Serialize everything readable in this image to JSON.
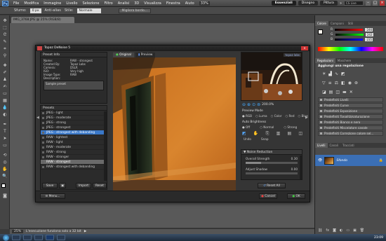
{
  "app": {
    "logo": "Ps",
    "menu": [
      "File",
      "Modifica",
      "Immagine",
      "Livello",
      "Selezione",
      "Filtro",
      "Analisi",
      "3D",
      "Visualizza",
      "Finestra",
      "Aiuto"
    ],
    "zoom_indicator": "33%",
    "workspaces": [
      "Essenziali",
      "Disegno",
      "Pittura"
    ],
    "active_workspace": "Essenziali",
    "cs_live": "CS Live"
  },
  "options_bar": {
    "sfumo_label": "Sfumo:",
    "sfumo_value": "0 px",
    "antialias_label": "Anti-alias",
    "stile_label": "Stile:",
    "stile_value": "Normale",
    "migliora_bordo": "Migliora bordo..."
  },
  "document": {
    "tab_label": "IMG_3768.JPG @ 25% (RGB/8)",
    "zoom": "25%",
    "status": "L'esecuzione funziona solo a 32 bit"
  },
  "dialog": {
    "title": "Topaz DeNoise 5",
    "brand": "topaz labs",
    "preset_info": {
      "header": "Preset Info",
      "name_label": "Name:",
      "name_value": "RAW - strongest",
      "created_label": "Created By:",
      "created_value": "Topaz Labs",
      "camera_label": "Camera:",
      "camera_value": "DSLR",
      "iso_label": "ISO:",
      "iso_value": "Very high",
      "type_label": "Image Type:",
      "type_value": "RAW",
      "desc_label": "Description:",
      "desc_value": "Sample preset"
    },
    "presets_header": "Presets",
    "presets": [
      "JPEG - light",
      "JPEG - moderate",
      "JPEG - strong",
      "JPEG - strongest",
      "JPEG - strongest with debanding",
      "RAW - lightest",
      "RAW - light",
      "RAW - moderate",
      "RAW - strong",
      "RAW - stronger",
      "RAW - strongest",
      "RAW - strongest with debanding"
    ],
    "selected_preset_index": 4,
    "highlighted_preset_index": 10,
    "preset_buttons": {
      "save": "Save",
      "import": "Import",
      "reset": "Reset"
    },
    "tabs": {
      "original": "Original",
      "preview": "Preview"
    },
    "zoom_level": "200.0%",
    "preview_mode": {
      "label": "Preview Mode",
      "options": [
        "RGB",
        "Luma",
        "Color",
        "Red",
        "Blue"
      ],
      "selected": "RGB"
    },
    "auto_brightness": {
      "label": "Auto Brightness",
      "options": [
        "Off",
        "Normal",
        "Strong"
      ],
      "selected": "Off"
    },
    "tools": {
      "undo": "Undo",
      "snap": "Snap"
    },
    "noise_reduction": {
      "header": "Noise Reduction",
      "overall_strength_label": "Overall Strength",
      "overall_strength_value": "0.30",
      "adjust_shadow_label": "Adjust Shadow",
      "adjust_shadow_value": "0.00"
    },
    "reset_all": "Reset All",
    "menu_button": "Menu...",
    "cancel": "Cancel",
    "ok": "OK"
  },
  "color_panel": {
    "tabs": [
      "Colore",
      "Campioni",
      "Stili"
    ],
    "r_value": "246",
    "g_value": "242",
    "b_value": "235"
  },
  "adjustments_panel": {
    "tabs": [
      "Regolazioni",
      "Maschere"
    ],
    "title": "Aggiungi una regolazione",
    "preset_rows": [
      "Predefiniti Livelli",
      "Predefiniti Curve",
      "Predefiniti Esposizione",
      "Predefiniti Tonalità/saturazione",
      "Predefiniti Bianco e nero",
      "Predefiniti Miscelatore canale",
      "Predefiniti Correzione colore sel..."
    ]
  },
  "layers_panel": {
    "tabs": [
      "Livelli",
      "Canali",
      "Tracciati"
    ],
    "layer_name": "Sfondo"
  },
  "taskbar": {
    "clock": "23:09"
  }
}
